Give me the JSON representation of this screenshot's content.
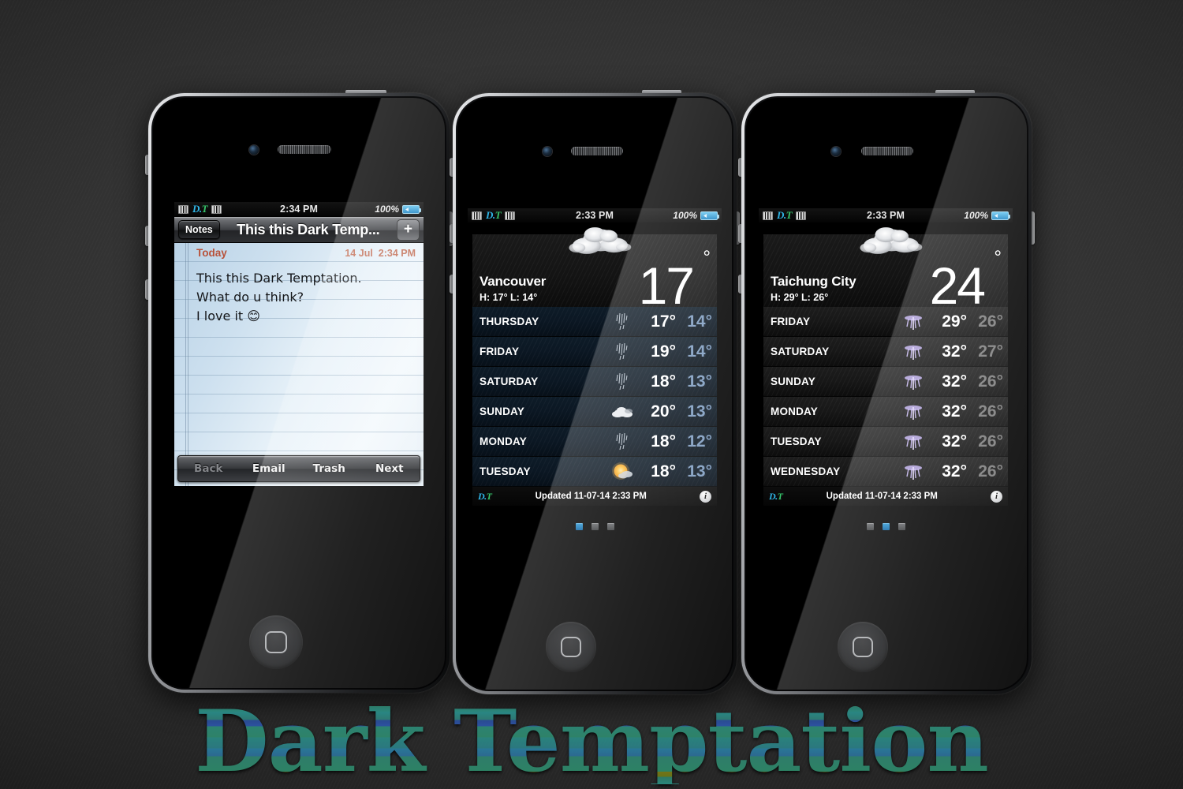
{
  "wallpaper": {
    "title": "Dark Temptation",
    "background_color": "#2f2f2f"
  },
  "phones": [
    {
      "id": "phone-notes",
      "status_bar": {
        "carrier_icon": "signal-bars-icon",
        "logo": {
          "first": "D.",
          "second": "T"
        },
        "second_icon": "signal-bars-icon",
        "time": "2:34 PM",
        "battery_percent": "100%",
        "battery_icon": "battery-charging-icon"
      },
      "app": "notes",
      "nav": {
        "back_label": "Notes",
        "title": "This this Dark Temp...",
        "add_label": "+"
      },
      "note": {
        "today_label": "Today",
        "date": "14 Jul",
        "time": "2:34 PM",
        "lines": [
          "This this Dark Temptation.",
          "What do u think?",
          "I love it  😊"
        ]
      },
      "toolbar": [
        {
          "label": "Back",
          "disabled": true
        },
        {
          "label": "Email",
          "disabled": false
        },
        {
          "label": "Trash",
          "disabled": false
        },
        {
          "label": "Next",
          "disabled": false
        }
      ]
    },
    {
      "id": "phone-weather-vancouver",
      "status_bar": {
        "carrier_icon": "signal-bars-icon",
        "logo": {
          "first": "D.",
          "second": "T"
        },
        "second_icon": "signal-bars-icon",
        "time": "2:33 PM",
        "battery_percent": "100%",
        "battery_icon": "battery-charging-icon"
      },
      "app": "weather",
      "theme": "blue",
      "current": {
        "city": "Vancouver",
        "condition_icon": "cloud-icon",
        "high_low": "H: 17° L: 14°",
        "temp": "17",
        "degree": "°"
      },
      "forecast": [
        {
          "day": "THURSDAY",
          "icon": "rain-icon",
          "high": "17°",
          "low": "14°"
        },
        {
          "day": "FRIDAY",
          "icon": "rain-icon",
          "high": "19°",
          "low": "14°"
        },
        {
          "day": "SATURDAY",
          "icon": "rain-icon",
          "high": "18°",
          "low": "13°"
        },
        {
          "day": "SUNDAY",
          "icon": "partly-cloudy-icon",
          "high": "20°",
          "low": "13°"
        },
        {
          "day": "MONDAY",
          "icon": "rain-icon",
          "high": "18°",
          "low": "12°"
        },
        {
          "day": "TUESDAY",
          "icon": "sun-cloud-icon",
          "high": "18°",
          "low": "13°"
        }
      ],
      "footer": {
        "logo_first": "D.",
        "logo_second": "T",
        "updated_label": "Updated",
        "updated_date": "11-07-14",
        "updated_time": "2:33 PM",
        "info_icon": "info-icon"
      },
      "page_dots": {
        "count": 3,
        "active": 0
      }
    },
    {
      "id": "phone-weather-taichung",
      "status_bar": {
        "carrier_icon": "signal-bars-icon",
        "logo": {
          "first": "D.",
          "second": "T"
        },
        "second_icon": "signal-bars-icon",
        "time": "2:33 PM",
        "battery_percent": "100%",
        "battery_icon": "battery-charging-icon"
      },
      "app": "weather",
      "theme": "grey",
      "current": {
        "city": "Taichung City",
        "condition_icon": "cloud-icon",
        "high_low": "H: 29° L: 26°",
        "temp": "24",
        "degree": "°"
      },
      "forecast": [
        {
          "day": "FRIDAY",
          "icon": "thunderstorm-icon",
          "high": "29°",
          "low": "26°"
        },
        {
          "day": "SATURDAY",
          "icon": "thunderstorm-icon",
          "high": "32°",
          "low": "27°"
        },
        {
          "day": "SUNDAY",
          "icon": "thunderstorm-icon",
          "high": "32°",
          "low": "26°"
        },
        {
          "day": "MONDAY",
          "icon": "thunderstorm-icon",
          "high": "32°",
          "low": "26°"
        },
        {
          "day": "TUESDAY",
          "icon": "thunderstorm-icon",
          "high": "32°",
          "low": "26°"
        },
        {
          "day": "WEDNESDAY",
          "icon": "thunderstorm-icon",
          "high": "32°",
          "low": "26°"
        }
      ],
      "footer": {
        "logo_first": "D.",
        "logo_second": "T",
        "updated_label": "Updated",
        "updated_date": "11-07-14",
        "updated_time": "2:33 PM",
        "info_icon": "info-icon"
      },
      "page_dots": {
        "count": 3,
        "active": 1
      }
    }
  ]
}
